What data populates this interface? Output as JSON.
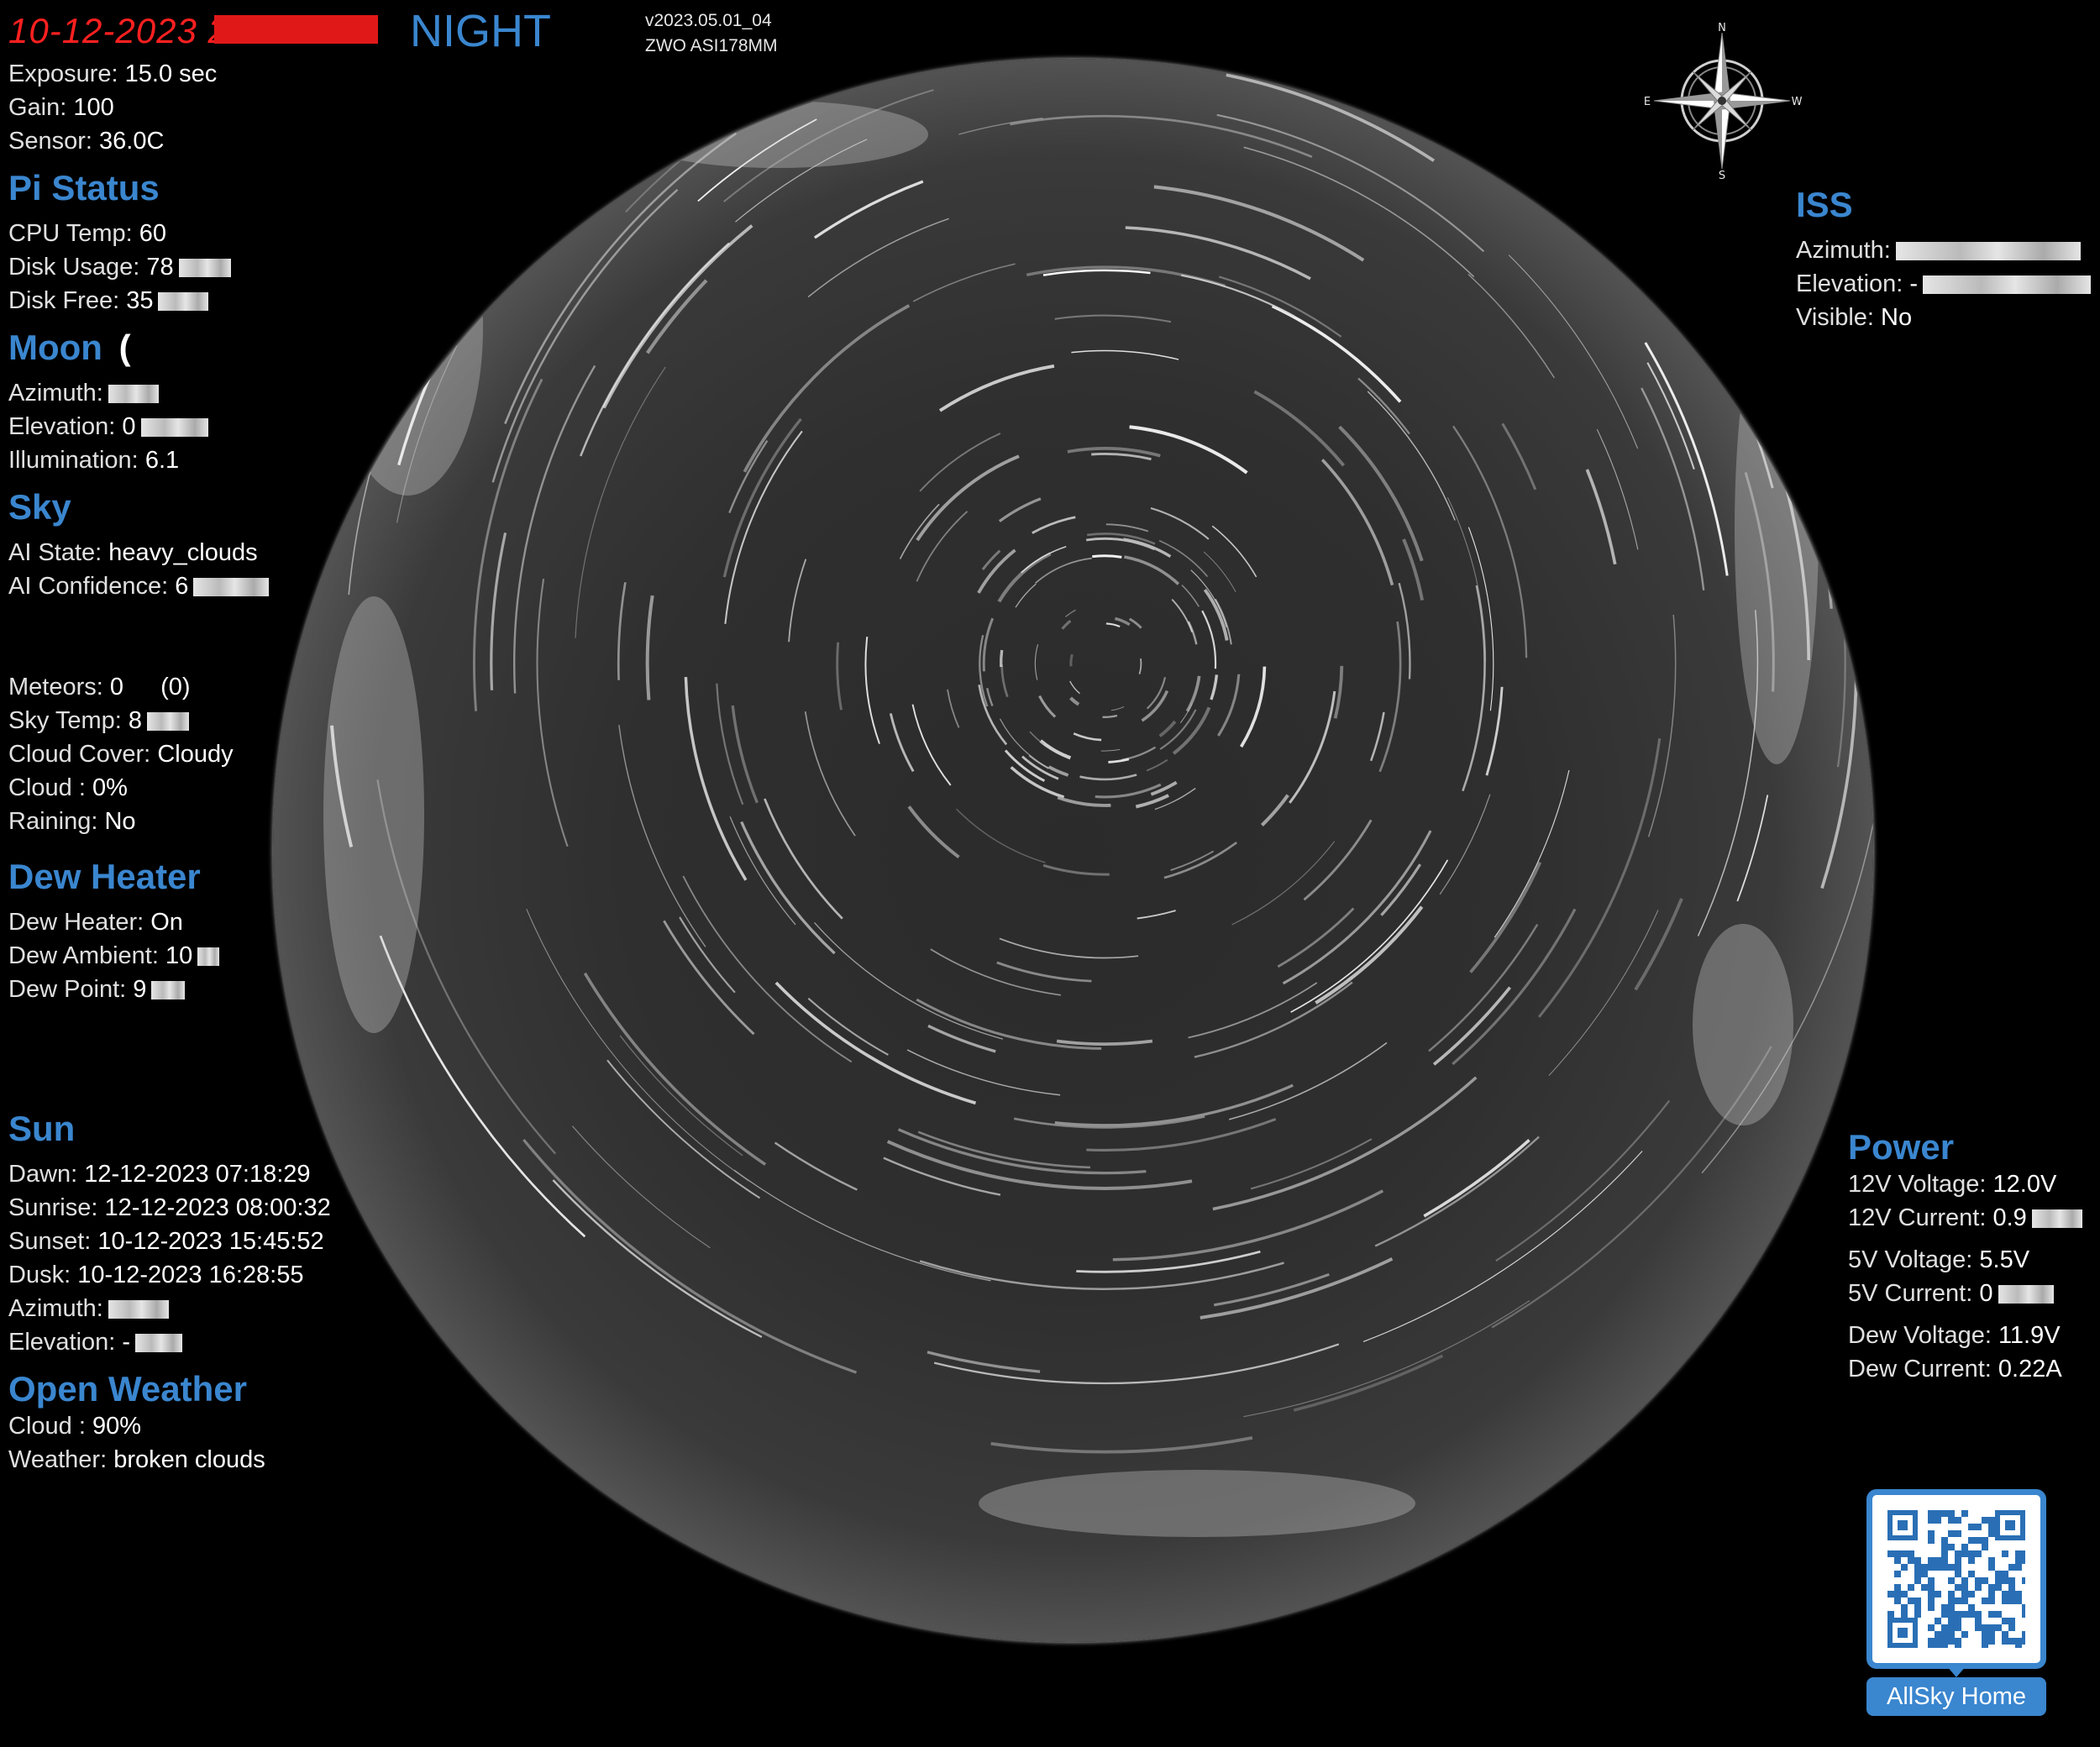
{
  "header": {
    "timestamp": "10-12-2023 23:00:00",
    "mode": "NIGHT",
    "version": "v2023.05.01_04",
    "camera": "ZWO ASI178MM"
  },
  "camera_info": {
    "exposure_label": "Exposure:",
    "exposure_value": "15.0 sec",
    "gain_label": "Gain:",
    "gain_value": "100",
    "sensor_label": "Sensor:",
    "sensor_value": "36.0C"
  },
  "pi_status": {
    "title": "Pi Status",
    "cpu_label": "CPU Temp:",
    "cpu_value": "60",
    "disk_usage_label": "Disk Usage:",
    "disk_usage_value": "78",
    "disk_free_label": "Disk Free:",
    "disk_free_value": "35"
  },
  "moon": {
    "title": "Moon",
    "symbol": "(",
    "azimuth_label": "Azimuth:",
    "elevation_label": "Elevation:",
    "elevation_value": "0",
    "illumination_label": "Illumination:",
    "illumination_value": "6.1"
  },
  "sky": {
    "title": "Sky",
    "ai_state_label": "AI State:",
    "ai_state_value": "heavy_clouds",
    "ai_conf_label": "AI Confidence:",
    "ai_conf_value": "6",
    "meteors_label": "Meteors:",
    "meteors_value": "0",
    "meteors_extra": "(0)",
    "sky_temp_label": "Sky Temp:",
    "sky_temp_value": "8",
    "cloud_cover_label": "Cloud Cover:",
    "cloud_cover_value": "Cloudy",
    "cloud_label": "Cloud :",
    "cloud_value": "0%",
    "raining_label": "Raining:",
    "raining_value": "No"
  },
  "dew_heater": {
    "title": "Dew Heater",
    "heater_label": "Dew Heater:",
    "heater_value": "On",
    "ambient_label": "Dew Ambient:",
    "ambient_value": "10",
    "point_label": "Dew Point:",
    "point_value": "9"
  },
  "sun": {
    "title": "Sun",
    "dawn_label": "Dawn:",
    "dawn_value": "12-12-2023 07:18:29",
    "sunrise_label": "Sunrise:",
    "sunrise_value": "12-12-2023 08:00:32",
    "sunset_label": "Sunset:",
    "sunset_value": "10-12-2023 15:45:52",
    "dusk_label": "Dusk:",
    "dusk_value": "10-12-2023 16:28:55",
    "azimuth_label": "Azimuth:",
    "elevation_label": "Elevation:",
    "elevation_value": "-"
  },
  "open_weather": {
    "title": "Open Weather",
    "cloud_label": "Cloud :",
    "cloud_value": "90%",
    "weather_label": "Weather:",
    "weather_value": "broken clouds"
  },
  "iss": {
    "title": "ISS",
    "azimuth_label": "Azimuth:",
    "elevation_label": "Elevation:",
    "elevation_value": "-",
    "visible_label": "Visible:",
    "visible_value": "No"
  },
  "power": {
    "title": "Power",
    "v12_label": "12V Voltage:",
    "v12_value": "12.0",
    "v12_unit": "V",
    "c12_label": "12V Current:",
    "c12_value": "0.9",
    "v5_label": "5V Voltage:",
    "v5_value": "5.5",
    "v5_unit": "V",
    "c5_label": "5V Current:",
    "c5_value": "0",
    "dewv_label": "Dew Voltage:",
    "dewv_value": "11.9",
    "dewv_unit": "V",
    "dewc_label": "Dew Current:",
    "dewc_value": "0.22",
    "dewc_unit": "A"
  },
  "compass": {
    "north": "N",
    "south": "S",
    "east": "E",
    "west": "W"
  },
  "qr": {
    "label": "AllSky Home"
  },
  "colors": {
    "accent": "#3a86cf",
    "timestamp": "#ff2020",
    "background": "#000000"
  }
}
